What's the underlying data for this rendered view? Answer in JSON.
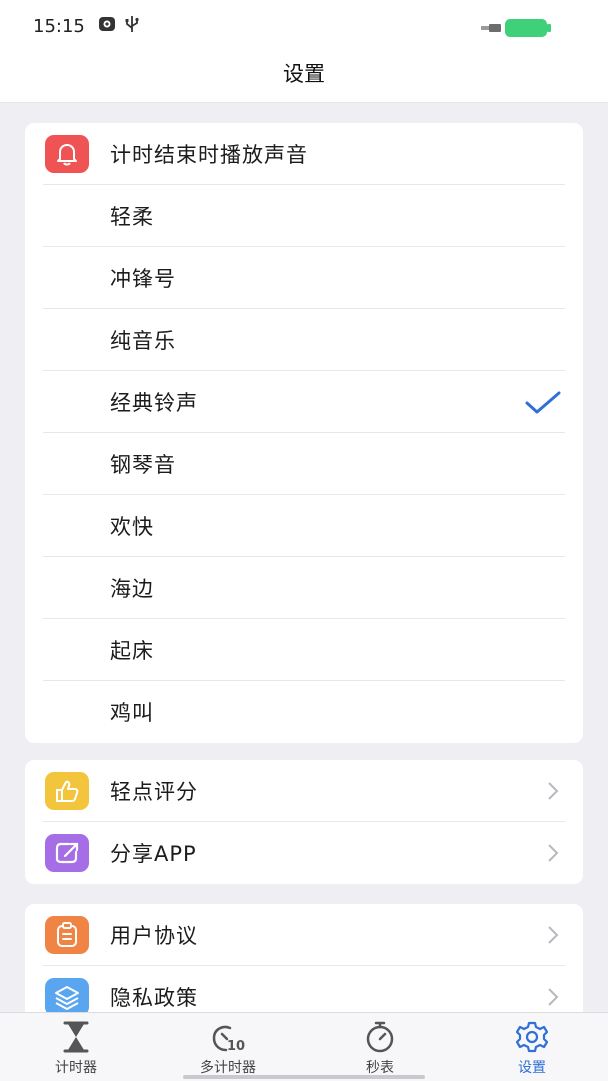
{
  "status_bar": {
    "time": "15:15"
  },
  "header": {
    "title": "设置"
  },
  "sound_section": {
    "title": "计时结束时播放声音",
    "options": [
      {
        "label": "轻柔"
      },
      {
        "label": "冲锋号"
      },
      {
        "label": "纯音乐"
      },
      {
        "label": "经典铃声",
        "selected": true
      },
      {
        "label": "钢琴音"
      },
      {
        "label": "欢快"
      },
      {
        "label": "海边"
      },
      {
        "label": "起床"
      },
      {
        "label": "鸡叫"
      }
    ]
  },
  "actions_section": {
    "items": [
      {
        "label": "轻点评分",
        "icon": "thumbs-up-icon",
        "color": "#f3c53c"
      },
      {
        "label": "分享APP",
        "icon": "share-icon",
        "color": "#a56ee6"
      }
    ]
  },
  "legal_section": {
    "items": [
      {
        "label": "用户协议",
        "icon": "clipboard-icon",
        "color": "#f08444"
      },
      {
        "label": "隐私政策",
        "icon": "layers-icon",
        "color": "#5aa5ef"
      }
    ]
  },
  "tabbar": {
    "tabs": [
      {
        "label": "计时器",
        "icon": "hourglass-icon"
      },
      {
        "label": "多计时器",
        "icon": "multi-timer-icon"
      },
      {
        "label": "秒表",
        "icon": "stopwatch-icon"
      },
      {
        "label": "设置",
        "icon": "gear-icon",
        "active": true
      }
    ]
  },
  "colors": {
    "accent": "#2f6fd6",
    "bell": "#ef5353",
    "background": "#eeeef3"
  }
}
